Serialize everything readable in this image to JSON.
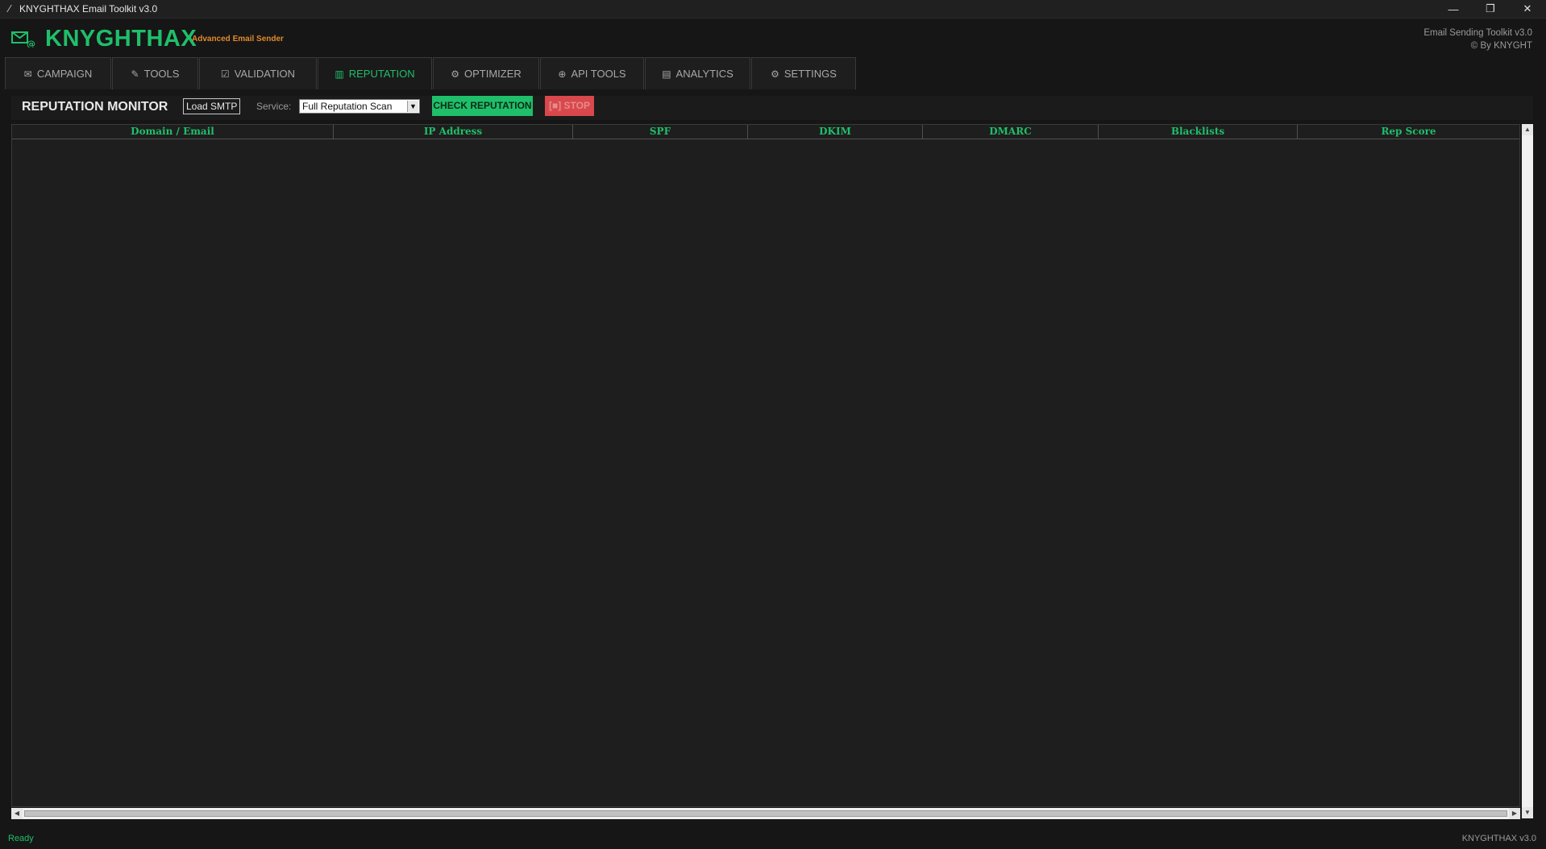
{
  "window": {
    "title": "KNYGHTHAX Email Toolkit v3.0",
    "minimize_glyph": "—",
    "maximize_glyph": "❐",
    "close_glyph": "✕"
  },
  "header": {
    "brand": "KNYGHTHAX",
    "tagline": "Advanced Email Sender",
    "right_line1": "Email Sending Toolkit v3.0",
    "right_line2": "© By KNYGHT",
    "logo_icon": "mail-at-icon"
  },
  "tabs": [
    {
      "label": "CAMPAIGN",
      "icon": "campaign-icon",
      "glyph": "✉"
    },
    {
      "label": "TOOLS",
      "icon": "wrench-icon",
      "glyph": "✎"
    },
    {
      "label": "VALIDATION",
      "icon": "checkbox-icon",
      "glyph": "☑"
    },
    {
      "label": "REPUTATION",
      "icon": "bar-chart-icon",
      "glyph": "▥"
    },
    {
      "label": "OPTIMIZER",
      "icon": "optimizer-icon",
      "glyph": "⚙"
    },
    {
      "label": "API TOOLS",
      "icon": "globe-icon",
      "glyph": "⊕"
    },
    {
      "label": "ANALYTICS",
      "icon": "chart-icon",
      "glyph": "▤"
    },
    {
      "label": "SETTINGS",
      "icon": "gear-icon",
      "glyph": "⚙"
    }
  ],
  "active_tab": "REPUTATION",
  "toolbar": {
    "title": "REPUTATION MONITOR",
    "load_label": "Load SMTP",
    "service_label": "Service:",
    "service_value": "Full Reputation Scan",
    "check_label": "CHECK REPUTATION",
    "stop_label": "[■] STOP"
  },
  "table": {
    "columns": [
      "Domain / Email",
      "IP Address",
      "SPF",
      "DKIM",
      "DMARC",
      "Blacklists",
      "Rep Score"
    ],
    "rows": []
  },
  "status": {
    "left": "Ready",
    "right": "KNYGHTHAX v3.0"
  },
  "colors": {
    "accent": "#1fbf6a",
    "tagline": "#e08a2b",
    "danger": "#d9484c",
    "background": "#161616"
  }
}
